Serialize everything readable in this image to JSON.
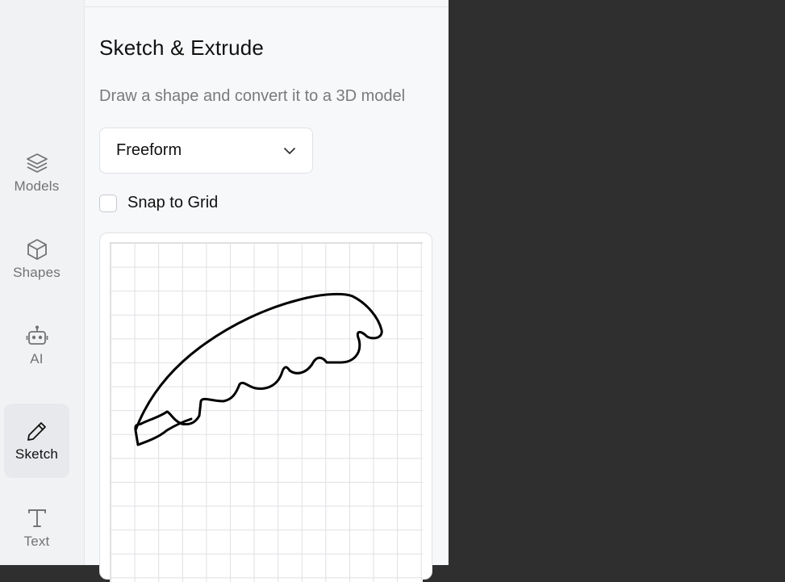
{
  "sidebar": {
    "items": [
      {
        "label": "Models",
        "icon": "layers-icon"
      },
      {
        "label": "Shapes",
        "icon": "cube-icon"
      },
      {
        "label": "AI",
        "icon": "robot-icon"
      },
      {
        "label": "Sketch",
        "icon": "pencil-icon",
        "active": true
      },
      {
        "label": "Text",
        "icon": "text-t-icon"
      }
    ]
  },
  "panel": {
    "title": "Sketch & Extrude",
    "subtitle": "Draw a shape and convert it to a 3D model",
    "mode_select": {
      "value": "Freeform"
    },
    "snap_to_grid": {
      "label": "Snap to Grid",
      "checked": false
    }
  },
  "colors": {
    "viewport_bg": "#2f2f2f",
    "panel_bg": "#f7f8fa",
    "sidebar_bg": "#f1f2f4",
    "stroke": "#000000"
  }
}
